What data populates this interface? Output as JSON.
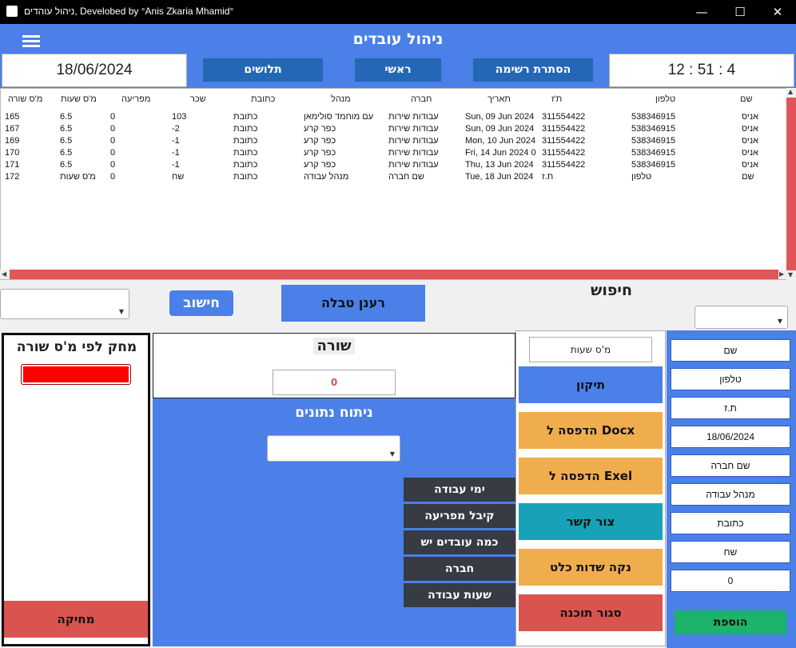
{
  "window": {
    "title": "ניהול עוהדים, Develobed by °Anis Zkaria Mhamid°",
    "minimize": "—",
    "maximize": "☐",
    "close": "✕"
  },
  "header": {
    "title": "ניהול עובדים"
  },
  "topbar": {
    "date": "18/06/2024",
    "time": "12 : 51 : 4",
    "nav": [
      "תלושים",
      "ראשי",
      "הסתרת רשימה"
    ]
  },
  "table": {
    "columns": [
      "שם",
      "טלפון",
      "ת'ז",
      "תאריך",
      "חברה",
      "מנהל",
      "כתובת",
      "שכר",
      "מפריעה",
      "מ'ס שעות",
      "מ'ס שורה"
    ],
    "rows": [
      [
        "אניס",
        "538346915",
        "311554422",
        "Sun, 09 Jun 2024",
        "עבודות שירות",
        "עם מוחמד סולימאן",
        "כתובת",
        "103",
        "0",
        "6.5",
        "165"
      ],
      [
        "אניס",
        "538346915",
        "311554422",
        "Sun, 09 Jun 2024",
        "עבודות שירות",
        "כפר קרע",
        "כתובת",
        "-2",
        "0",
        "6.5",
        "167"
      ],
      [
        "אניס",
        "538346915",
        "311554422",
        "Mon, 10 Jun 2024",
        "עבודות שירות",
        "כפר קרע",
        "כתובת",
        "-1",
        "0",
        "6.5",
        "169"
      ],
      [
        "אניס",
        "538346915",
        "311554422",
        "Fri, 14 Jun 2024 0",
        "עבודות שירות",
        "כפר קרע",
        "כתובת",
        "-1",
        "0",
        "6.5",
        "170"
      ],
      [
        "אניס",
        "538346915",
        "311554422",
        "Thu, 13 Jun 2024",
        "עבודות שירות",
        "כפר קרע",
        "כתובת",
        "-1",
        "0",
        "6.5",
        "171"
      ],
      [
        "שם",
        "טלפון",
        "ת.ז",
        "Tue, 18 Jun 2024",
        "שם חברה",
        "מנהל עבודה",
        "כתובת",
        "שח",
        "0",
        "מ'ס שעות",
        "172"
      ]
    ]
  },
  "middle": {
    "search_label": "חיפוש",
    "refresh_label": "רענן טבלה",
    "calc_label": "חישוב",
    "combo_caret": "▼"
  },
  "delete_panel": {
    "title": "מחק לפי מ'ס שורה",
    "button": "מחיקה"
  },
  "row_panel": {
    "title": "שורה",
    "value": "0"
  },
  "analysis": {
    "title": "ניתוח נתונים",
    "buttons": [
      "ימי עבודה",
      "קיבל מפריעה",
      "כמה עובדים יש",
      "חברה",
      "שעות עבודה"
    ]
  },
  "actions": {
    "hours_field": "מ'ס שעות",
    "fix": "תיקון",
    "print_docx": "הדפסה ל Docx",
    "print_excel": "הדפסה ל Exel",
    "contact": "צור קשר",
    "clear_fields": "נקה שדות כלט",
    "close_app": "סגור תוכנה"
  },
  "form": {
    "fields": [
      "שם",
      "טלפון",
      "ת.ז",
      "18/06/2024",
      "שם חברה",
      "מנהל עבודה",
      "כתובת",
      "שח",
      "0"
    ],
    "add_button": "הוספת"
  },
  "colors": {
    "accent": "#4a80e8",
    "nav_button": "#2467b5",
    "danger": "#d9534f",
    "warning": "#f0ad4e",
    "teal": "#17a2b8",
    "success": "#1db36b",
    "dark_button": "#363b44"
  }
}
